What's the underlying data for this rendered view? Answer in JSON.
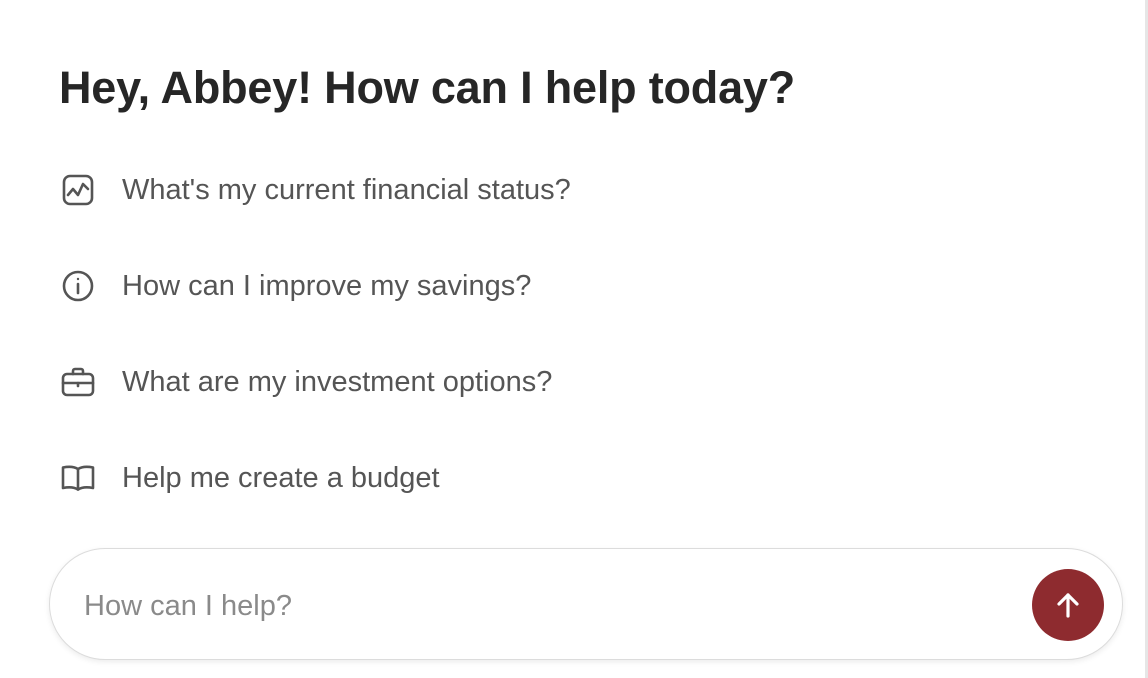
{
  "greeting": "Hey, Abbey! How can I help today?",
  "suggestions": [
    {
      "label": "What's my current financial status?",
      "icon": "chart-icon"
    },
    {
      "label": "How can I improve my savings?",
      "icon": "info-icon"
    },
    {
      "label": "What are my investment options?",
      "icon": "briefcase-icon"
    },
    {
      "label": "Help me create a budget",
      "icon": "book-icon"
    }
  ],
  "input": {
    "placeholder": "How can I help?",
    "value": ""
  },
  "send": {
    "icon": "arrow-up-icon"
  },
  "colors": {
    "accent": "#8e2b2f",
    "heading": "#262626",
    "text": "#555555",
    "placeholder": "#8a8a8a"
  }
}
